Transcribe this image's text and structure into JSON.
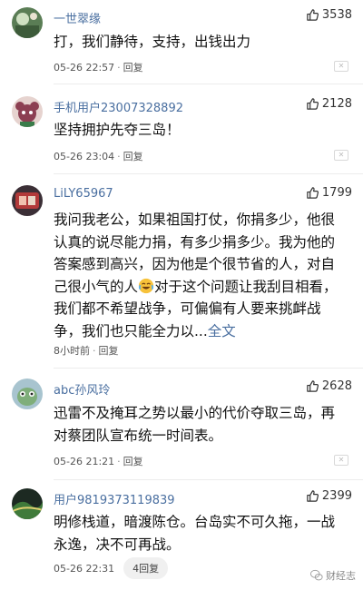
{
  "comments": [
    {
      "username": "一世翠缘",
      "likes": "3538",
      "text": "打，我们静待，支持，出钱出力",
      "date": "05-26 22:57",
      "reply": "回复",
      "avatar": "avatar-green-icon"
    },
    {
      "username": "手机用户23007328892",
      "likes": "2128",
      "text": "坚持拥护先夺三岛！",
      "date": "05-26 23:04",
      "reply": "回复",
      "avatar": "avatar-dog-icon"
    },
    {
      "username": "LiLY65967",
      "likes": "1799",
      "text_before_emoji": "我问我老公，如果祖国打仗，你捐多少，他很认真的说尽能力捐，有多少捐多少。我为他的答案感到高兴，因为他是个很节省的人，对自己很小气的人",
      "text_after_emoji": "对于这个问题让我刮目相看，我们都不希望战争，可偏偏有人要来挑衅战争，我们也只能全力以...",
      "full_text_link": "全文",
      "date": "8小时前",
      "reply": "回复",
      "avatar": "avatar-photo-icon",
      "emoji": "crying-laugh-emoji-icon"
    },
    {
      "username": "abc孙风玲",
      "likes": "2628",
      "text": "迅雷不及掩耳之势以最小的代价夺取三岛，再对蔡团队宣布统一时间表。",
      "date": "05-26 21:21",
      "reply": "回复",
      "avatar": "avatar-cartoon-icon"
    },
    {
      "username": "用户9819373119839",
      "likes": "2399",
      "text": "明修栈道，暗渡陈仓。台岛实不可久拖，一战永逸，决不可再战。",
      "date": "05-26 22:31",
      "reply": "4回复",
      "avatar": "avatar-landscape-icon"
    }
  ],
  "watermark": "财经志",
  "colors": {
    "username": "#4a6fa0",
    "text": "#111111",
    "meta": "#555555",
    "divider": "#ececec"
  }
}
